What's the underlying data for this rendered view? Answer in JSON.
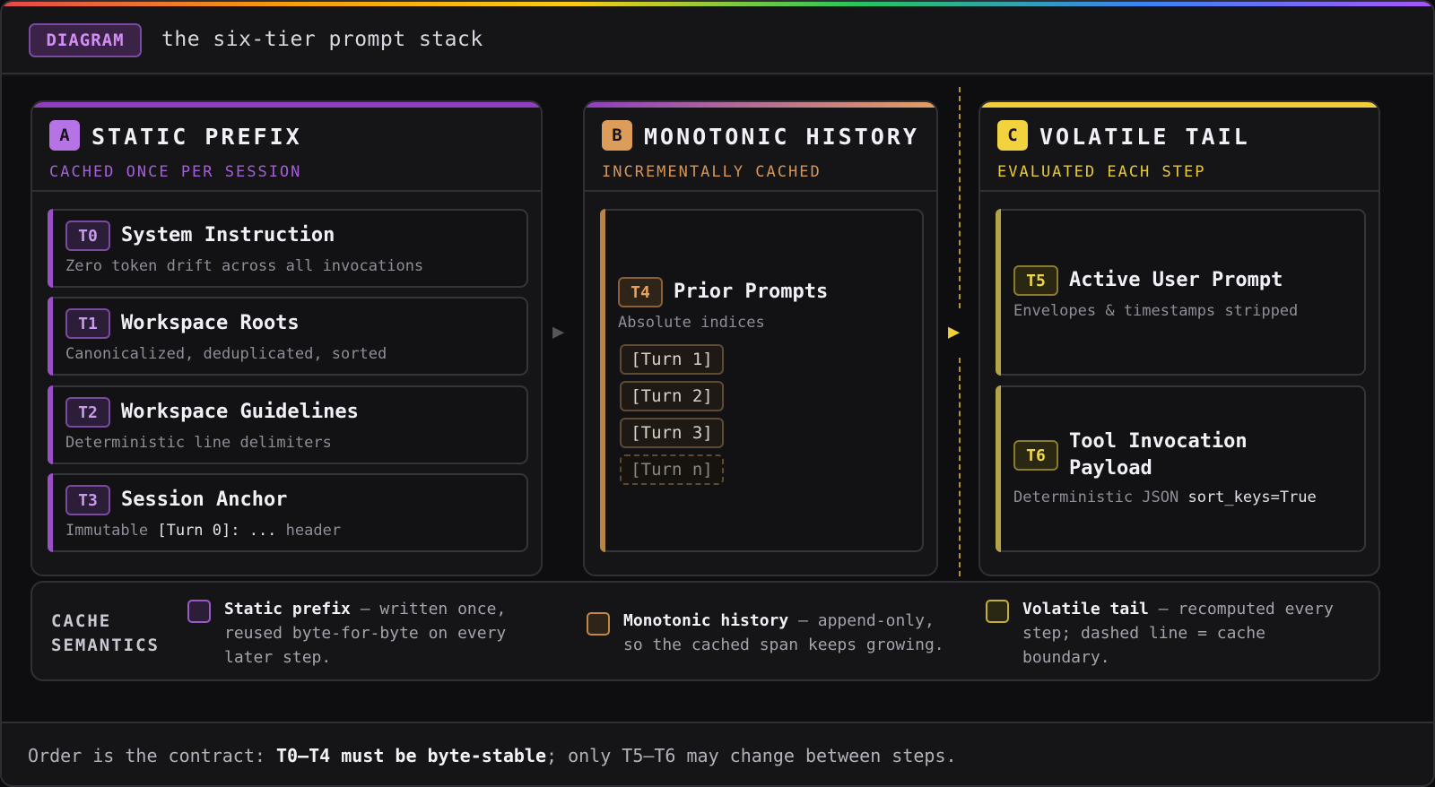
{
  "header": {
    "tag": "DIAGRAM",
    "title": "the six-tier prompt stack"
  },
  "panels": {
    "a": {
      "letter": "A",
      "title": "STATIC PREFIX",
      "subtitle": "CACHED ONCE PER SESSION",
      "tiers": [
        {
          "badge": "T0",
          "title": "System Instruction",
          "desc": "Zero token drift across all invocations"
        },
        {
          "badge": "T1",
          "title": "Workspace Roots",
          "desc": "Canonicalized, deduplicated, sorted"
        },
        {
          "badge": "T2",
          "title": "Workspace Guidelines",
          "desc": "Deterministic line delimiters"
        },
        {
          "badge": "T3",
          "title": "Session Anchor",
          "desc_pre": "Immutable ",
          "desc_code": "[Turn 0]: ...",
          "desc_post": " header"
        }
      ]
    },
    "b": {
      "letter": "B",
      "title": "MONOTONIC HISTORY",
      "subtitle": "INCREMENTALLY CACHED",
      "tier": {
        "badge": "T4",
        "title": "Prior Prompts",
        "desc": "Absolute indices"
      },
      "turns": [
        "[Turn 1]",
        "[Turn 2]",
        "[Turn 3]",
        "[Turn n]"
      ]
    },
    "c": {
      "letter": "C",
      "title": "VOLATILE TAIL",
      "subtitle": "EVALUATED EACH STEP",
      "tiers": [
        {
          "badge": "T5",
          "title": "Active User Prompt",
          "desc": "Envelopes & timestamps stripped"
        },
        {
          "badge": "T6",
          "title_line1": "Tool Invocation",
          "title_line2": "Payload",
          "desc_pre": "Deterministic JSON ",
          "desc_code": "sort_keys=True"
        }
      ]
    }
  },
  "arrows": {
    "first": "▶",
    "second": "▶"
  },
  "legend": {
    "title_line1": "CACHE",
    "title_line2": "SEMANTICS",
    "items": [
      {
        "bold": "Static prefix",
        "line1": " — written once,",
        "line2": "reused byte-for-byte on every",
        "line3": "later step."
      },
      {
        "bold": "Monotonic history",
        "line1": " — append-only,",
        "line2": "so the cached span keeps growing."
      },
      {
        "bold": "Volatile tail",
        "line1": " — recomputed every",
        "line2": "step; dashed line = cache",
        "line3": "boundary."
      }
    ]
  },
  "footer": {
    "pre": "Order is the contract: ",
    "bold": "T0–T4 must be byte-stable",
    "post": "; only T5–T6 may change between steps."
  },
  "colors": {
    "purple": "#9a4fc7",
    "orange": "#d99a56",
    "yellow": "#f0cf3a"
  }
}
